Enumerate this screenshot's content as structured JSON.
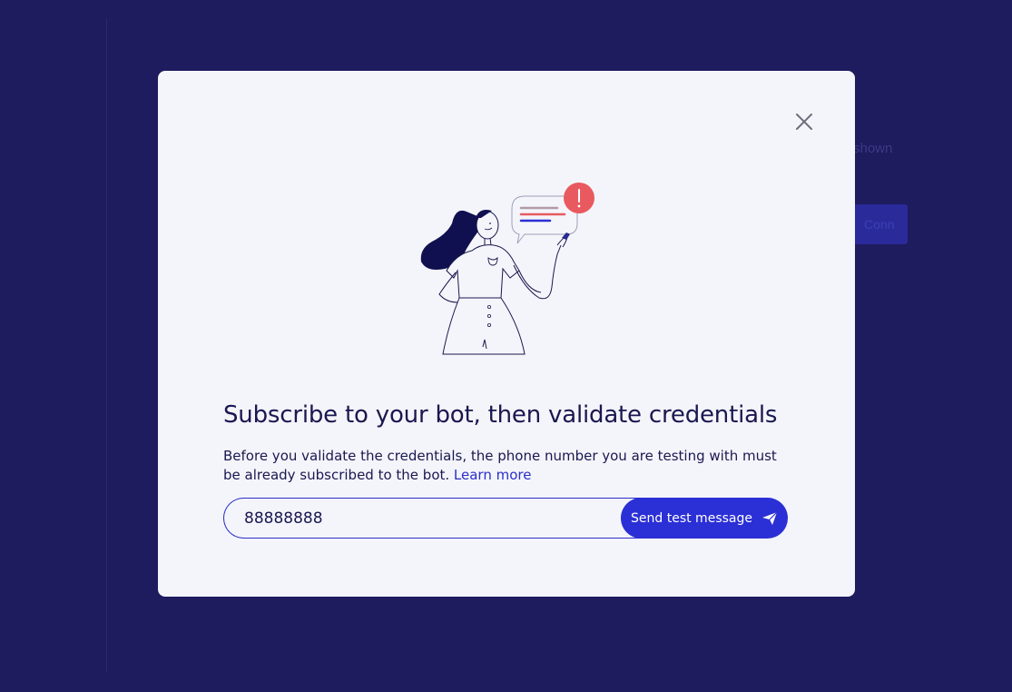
{
  "background": {
    "partial_text": "shown",
    "partial_button": "Conn"
  },
  "modal": {
    "close_icon": "close-icon",
    "illustration": "woman-with-alert-message-illustration",
    "title": "Subscribe to your bot, then validate credentials",
    "description": "Before you validate the credentials, the phone number you are testing with must be already subscribed to the bot.",
    "learn_more": "Learn more",
    "phone_input": {
      "value": "88888888",
      "placeholder": ""
    },
    "send_button": {
      "label": "Send test message",
      "icon": "send-paper-plane-icon"
    }
  },
  "colors": {
    "backdrop": "#1e1b5e",
    "modal_bg": "#f4f5fa",
    "primary": "#2b2fd6",
    "text": "#1a1850",
    "alert": "#e85a5f"
  }
}
